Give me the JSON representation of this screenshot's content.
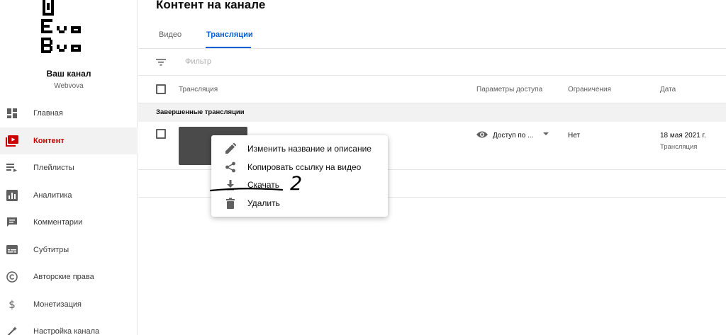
{
  "channel": {
    "name": "Ваш канал",
    "handle": "Webvova"
  },
  "sidebar": {
    "items": [
      {
        "label": "Главная",
        "icon": "dashboard-icon",
        "active": false
      },
      {
        "label": "Контент",
        "icon": "content-icon",
        "active": true
      },
      {
        "label": "Плейлисты",
        "icon": "playlists-icon",
        "active": false
      },
      {
        "label": "Аналитика",
        "icon": "analytics-icon",
        "active": false
      },
      {
        "label": "Комментарии",
        "icon": "comments-icon",
        "active": false
      },
      {
        "label": "Субтитры",
        "icon": "subtitles-icon",
        "active": false
      },
      {
        "label": "Авторские права",
        "icon": "copyright-icon",
        "active": false
      },
      {
        "label": "Монетизация",
        "icon": "dollar-icon",
        "active": false
      },
      {
        "label": "Настройка канала",
        "icon": "customization-icon",
        "active": false
      }
    ]
  },
  "main": {
    "title": "Контент на канале",
    "tabs": [
      {
        "label": "Видео",
        "active": false
      },
      {
        "label": "Трансляции",
        "active": true
      }
    ],
    "filter": {
      "placeholder": "Фильтр"
    },
    "table": {
      "headers": {
        "stream": "Трансляция",
        "visibility": "Параметры доступа",
        "restrictions": "Ограничения",
        "date": "Дата"
      },
      "section_label": "Завершенные трансляции",
      "rows": [
        {
          "visibility": "Доступ по ...",
          "restrictions": "Нет",
          "date": "18 мая 2021 г.",
          "date_sub": "Трансляция"
        }
      ]
    }
  },
  "context_menu": {
    "items": [
      {
        "label": "Изменить название и описание",
        "icon": "pencil-icon"
      },
      {
        "label": "Копировать ссылку на видео",
        "icon": "share-icon"
      },
      {
        "label": "Скачать",
        "icon": "download-icon"
      },
      {
        "label": "Удалить",
        "icon": "trash-icon"
      }
    ]
  },
  "annotation": {
    "text": "2"
  },
  "colors": {
    "accent_blue": "#065fd4",
    "active_red": "#cc0000",
    "thumbnail": "#4a4a4a"
  }
}
